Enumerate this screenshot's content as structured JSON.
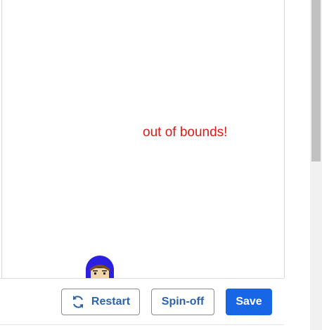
{
  "stage": {
    "status_message": "out of bounds!",
    "status_color": "#dd1a1a"
  },
  "toolbar": {
    "restart_label": "Restart",
    "spinoff_label": "Spin-off",
    "save_label": "Save",
    "restart_icon": "refresh-icon",
    "accent_color": "#1766e6"
  },
  "sprite": {
    "icon": "character-avatar-icon",
    "helmet_color": "#2b1fe0"
  }
}
